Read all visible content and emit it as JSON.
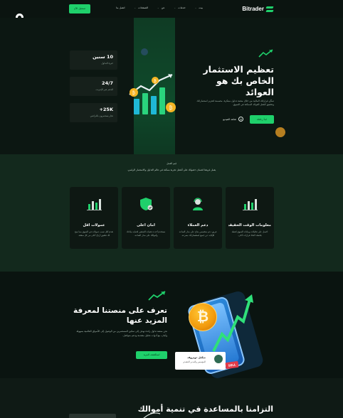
{
  "brand": {
    "name": "Bitrader",
    "accent": "#1fd06b"
  },
  "header": {
    "nav": [
      {
        "label": "بيت",
        "dropdown": true
      },
      {
        "label": "خدمات",
        "dropdown": true
      },
      {
        "label": "عن",
        "dropdown": true
      },
      {
        "label": "الصفحات",
        "dropdown": true
      },
      {
        "label": "اتصل بنا",
        "dropdown": false
      }
    ],
    "register_label": "تسجيل الآن",
    "theme_toggle_icon": "moon-icon"
  },
  "hero": {
    "title": "تعظيم الاستثمار الخاص بك هو العوائد",
    "description": "تمكّن قراراتك المالية من خلال منصة تداول مبتكرة، مصممة لتعزيز استثماراتك وتحقيق أفضل العوائد الممكنة في السوق.",
    "start_label": "ابدأ رحلتك",
    "video_label": "شاهد الفيديو",
    "stats": [
      {
        "value": "10 سنين",
        "label": "خبرة التداول"
      },
      {
        "value": "24/7",
        "label": "الدعم عبر الإنترنت"
      },
      {
        "value": "25K+",
        "label": "تجار يستثمرون بالتراضي"
      }
    ]
  },
  "features": {
    "heading": "قيم العمل",
    "intro": "يعمل فريقنا لضمان حصولك على أفضل تجربة ممكنة في عالم التداول والاستثمار الرقمي.",
    "cards": [
      {
        "title": "عمولات أقل",
        "description": "نقدم أقل نسب عمولات في السوق مما يتيح لك تحقيق أرباح أعلى من كل صفقة.",
        "icon": "chart-icon"
      },
      {
        "title": "أمان أعلى",
        "description": "نستخدم أحدث تقنيات التشفير لحماية بياناتك وأموالك على مدار الساعة.",
        "icon": "shield-icon"
      },
      {
        "title": "دعم العملاء",
        "description": "فريق دعم متخصص متاح على مدار الساعة للإجابة عن جميع استفساراتك بسرعة.",
        "icon": "support-icon"
      },
      {
        "title": "معلومات الوقت الحقيقي",
        "description": "احصل على تحليلات وبيانات السوق لحظة بلحظة لاتخاذ قرارات أذكى.",
        "icon": "chart-icon"
      }
    ]
  },
  "about": {
    "title": "تعرف على منصتنا لمعرفة المزيد عنها",
    "description": "نحن منصة تداول رائدة تهدف إلى تمكين المستثمرين من الوصول إلى الأسواق العالمية بسهولة وأمان، مع أدوات تحليل متقدمة ودعم متواصل.",
    "button_label": "استكشف المزيد",
    "trader_name": "ميكيل دوبروف",
    "trader_role": "المؤسس والمدير التنفيذي",
    "sell_tag": "SELL"
  },
  "commitment": {
    "title": "التزامنا بالمساعدة في تنمية أموالك"
  }
}
